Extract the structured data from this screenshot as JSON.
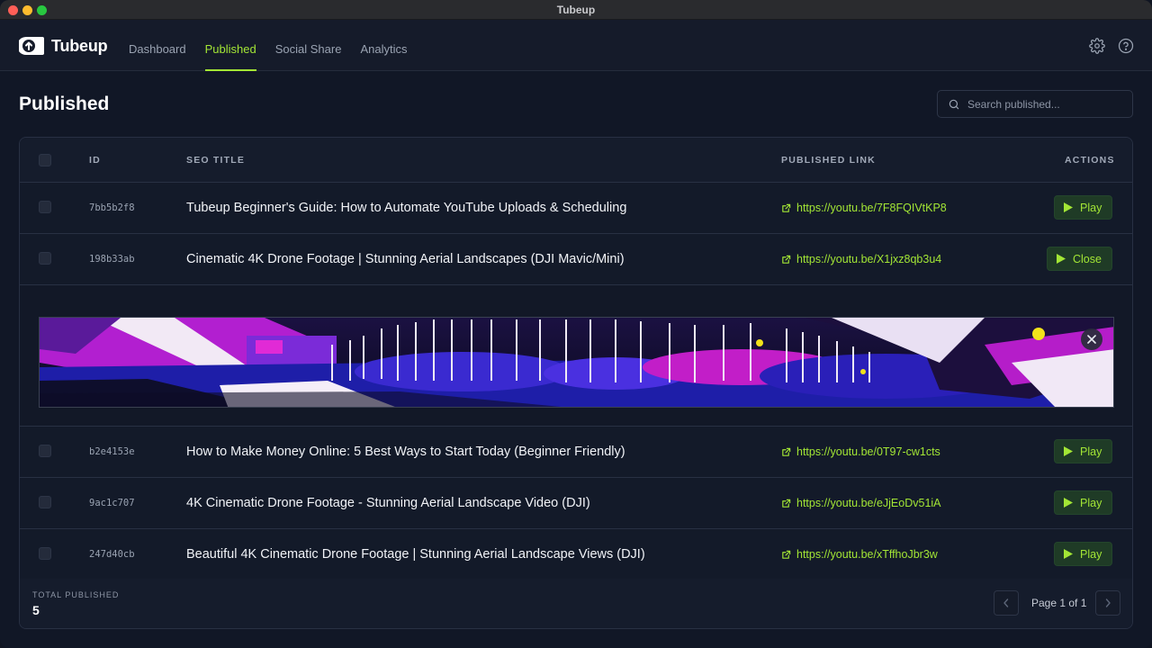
{
  "window": {
    "title": "Tubeup"
  },
  "brand": {
    "name": "Tubeup"
  },
  "nav": {
    "tabs": [
      {
        "label": "Dashboard",
        "active": false
      },
      {
        "label": "Published",
        "active": true
      },
      {
        "label": "Social Share",
        "active": false
      },
      {
        "label": "Analytics",
        "active": false
      }
    ],
    "icons": [
      "gear-icon",
      "help-icon"
    ]
  },
  "page": {
    "title": "Published"
  },
  "search": {
    "placeholder": "Search published..."
  },
  "table": {
    "headers": {
      "id": "ID",
      "seo_title": "SEO TITLE",
      "link": "PUBLISHED LINK",
      "actions": "ACTIONS"
    },
    "rows": [
      {
        "id": "7bb5b2f8",
        "title": "Tubeup Beginner's Guide: How to Automate YouTube Uploads & Scheduling",
        "link": "https://youtu.be/7F8FQIVtKP8",
        "action": "Play"
      },
      {
        "id": "198b33ab",
        "title": "Cinematic 4K Drone Footage | Stunning Aerial Landscapes (DJI Mavic/Mini)",
        "link": "https://youtu.be/X1jxz8qb3u4",
        "action": "Close"
      },
      {
        "id": "b2e4153e",
        "title": "How to Make Money Online: 5 Best Ways to Start Today (Beginner Friendly)",
        "link": "https://youtu.be/0T97-cw1cts",
        "action": "Play"
      },
      {
        "id": "9ac1c707",
        "title": "4K Cinematic Drone Footage - Stunning Aerial Landscape Video (DJI)",
        "link": "https://youtu.be/eJjEoDv51iA",
        "action": "Play"
      },
      {
        "id": "247d40cb",
        "title": "Beautiful 4K Cinematic Drone Footage | Stunning Aerial Landscape Views (DJI)",
        "link": "https://youtu.be/xTffhoJbr3w",
        "action": "Play"
      }
    ]
  },
  "footer": {
    "total_label": "TOTAL PUBLISHED",
    "total_value": "5",
    "pager_text": "Page 1 of 1"
  },
  "colors": {
    "accent": "#a3e635",
    "background": "#111726",
    "button_bg": "#1f3b26"
  }
}
